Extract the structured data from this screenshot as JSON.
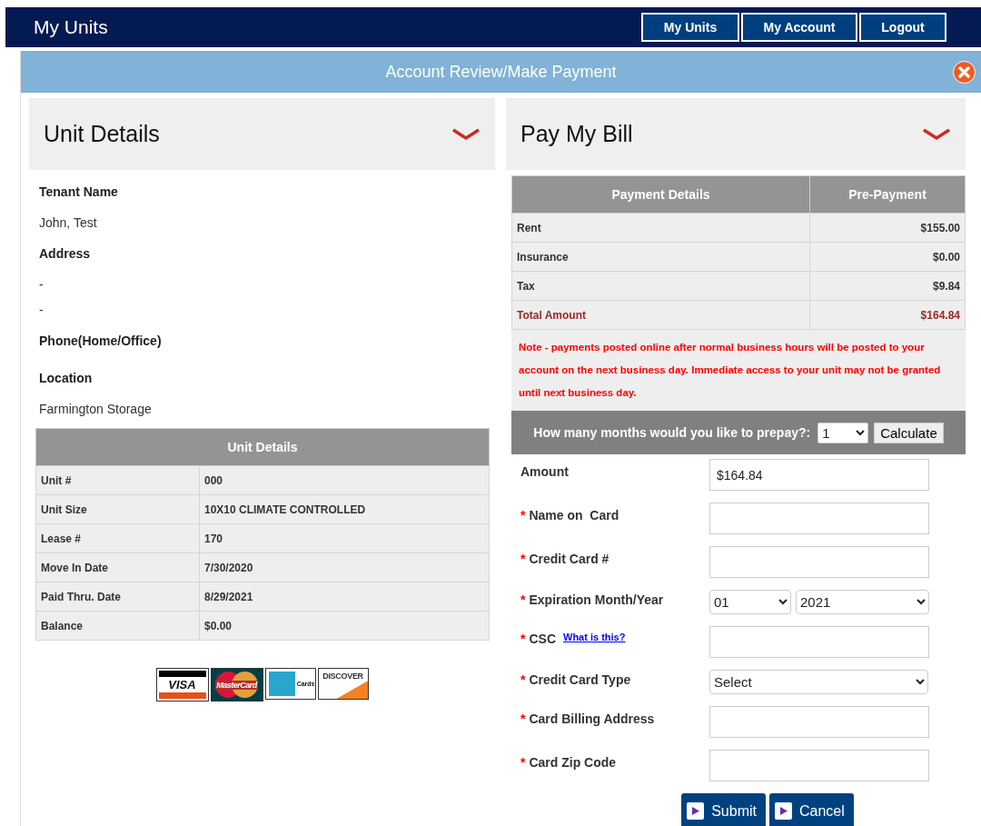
{
  "header": {
    "title": "My Units",
    "nav": [
      {
        "label": "My Units"
      },
      {
        "label": "My Account"
      },
      {
        "label": "Logout"
      }
    ]
  },
  "modal": {
    "title": "Account Review/Make Payment"
  },
  "unit_panel": {
    "title": "Unit Details"
  },
  "tenant_fields": [
    {
      "label": "Tenant Name",
      "values": [
        "John, Test"
      ]
    },
    {
      "label": "Address",
      "values": [
        "-",
        "-"
      ]
    },
    {
      "label": "Phone(Home/Office)"
    },
    {
      "label": "Location",
      "values": [
        "Farmington Storage"
      ]
    }
  ],
  "unit_table": {
    "title": "Unit Details",
    "rows": [
      {
        "label": "Unit #",
        "value": "000"
      },
      {
        "label": "Unit Size",
        "value": "10X10 CLIMATE CONTROLLED"
      },
      {
        "label": "Lease #",
        "value": "170"
      },
      {
        "label": "Move In Date",
        "value": "7/30/2020"
      },
      {
        "label": "Paid Thru. Date",
        "value": "8/29/2021"
      },
      {
        "label": "Balance",
        "value": "$0.00"
      }
    ]
  },
  "card_logos": [
    {
      "kind": "visa",
      "text": "VISA"
    },
    {
      "kind": "mastercard",
      "text": "MasterCard"
    },
    {
      "kind": "amex",
      "text": "Cards"
    },
    {
      "kind": "discover",
      "text": "DISCOVER"
    }
  ],
  "bill_panel": {
    "title": "Pay My Bill"
  },
  "payment_table": {
    "columns": [
      "Payment Details",
      "Pre-Payment"
    ],
    "rows": [
      {
        "kind": "item",
        "label": "Rent",
        "value": "$155.00"
      },
      {
        "kind": "item",
        "label": "Insurance",
        "value": "$0.00"
      },
      {
        "kind": "item",
        "label": "Tax",
        "value": "$9.84"
      },
      {
        "kind": "total",
        "label": "Total Amount",
        "value": "$164.84"
      }
    ]
  },
  "note": "Note - payments posted online after normal business hours will be posted to your account on the next business day. Immediate access to your unit may not be granted until next business day.",
  "prepay": {
    "label": "How many months would you like to prepay?:",
    "value": "1",
    "button": "Calculate"
  },
  "form": [
    {
      "kind": "text",
      "label": "Amount",
      "value": "$164.84"
    },
    {
      "kind": "text",
      "label": "Name on  Card",
      "required_mark": "*"
    },
    {
      "kind": "text",
      "label": "Credit Card #",
      "required_mark": "*"
    },
    {
      "kind": "date",
      "label": "Expiration Month/Year",
      "required_mark": "*",
      "month": "01",
      "year": "2021"
    },
    {
      "kind": "text",
      "label": "CSC",
      "required_mark": "*",
      "link": "What is this?"
    },
    {
      "kind": "select",
      "label": "Credit Card Type",
      "required_mark": "*",
      "value": "Select"
    },
    {
      "kind": "text",
      "label": "Card Billing Address",
      "required_mark": "*"
    },
    {
      "kind": "text",
      "label": "Card Zip Code",
      "required_mark": "*"
    }
  ],
  "buttons": [
    "Submit",
    "Cancel"
  ]
}
